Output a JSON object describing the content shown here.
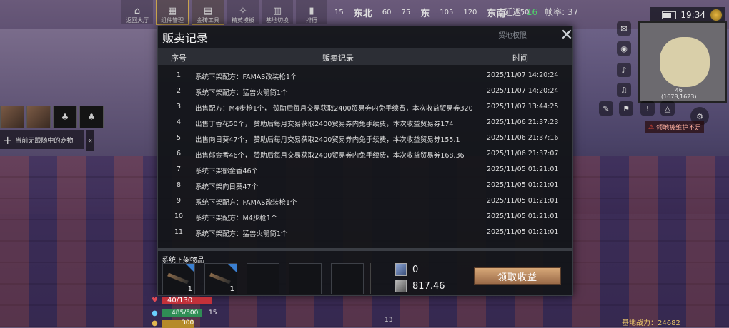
{
  "hud": {
    "home_label": "返回大厅",
    "buttons": [
      {
        "label": "组件管理",
        "active": true
      },
      {
        "label": "金砖工具",
        "active": true
      },
      {
        "label": "精英模板",
        "active": false
      },
      {
        "label": "基地切换",
        "active": false
      },
      {
        "label": "排行",
        "active": false
      }
    ],
    "compass": [
      "15",
      "东北",
      "60",
      "75",
      "东",
      "105",
      "120",
      "东南",
      "150"
    ],
    "latency_label": "延迟:",
    "latency_value": "16",
    "fps_label": "帧率:",
    "fps_value": "37",
    "clock": "19:34"
  },
  "minimap": {
    "coord_top": "46",
    "coord": "(1678,1623)"
  },
  "warning": "领地被维护不足",
  "left_panel": {
    "task_text": "当前无跟随中的宠物"
  },
  "modal": {
    "title": "贩卖记录",
    "faded_sub": "贸地权限",
    "columns": [
      "序号",
      "贩卖记录",
      "时间"
    ],
    "rows": [
      {
        "idx": "1",
        "text": "系统下架配方：FAMAS改装枪1个",
        "time": "2025/11/07 14:20:24"
      },
      {
        "idx": "2",
        "text": "系统下架配方：猛兽火箭筒1个",
        "time": "2025/11/07 14:20:24"
      },
      {
        "idx": "3",
        "text": "出售配方：M4步枪1个， 赞助后每月交易获取2400贸易券内免手续费，本次收益贸易券320",
        "time": "2025/11/07 13:44:25"
      },
      {
        "idx": "4",
        "text": "出售丁香花50个， 赞助后每月交易获取2400贸易券内免手续费，本次收益贸易券174",
        "time": "2025/11/06 21:37:23"
      },
      {
        "idx": "5",
        "text": "出售向日葵47个， 赞助后每月交易获取2400贸易券内免手续费，本次收益贸易券155.1",
        "time": "2025/11/06 21:37:16"
      },
      {
        "idx": "6",
        "text": "出售郁金香46个， 赞助后每月交易获取2400贸易券内免手续费，本次收益贸易券168.36",
        "time": "2025/11/06 21:37:07"
      },
      {
        "idx": "7",
        "text": "系统下架郁金香46个",
        "time": "2025/11/05 01:21:01"
      },
      {
        "idx": "8",
        "text": "系统下架向日葵47个",
        "time": "2025/11/05 01:21:01"
      },
      {
        "idx": "9",
        "text": "系统下架配方：FAMAS改装枪1个",
        "time": "2025/11/05 01:21:01"
      },
      {
        "idx": "10",
        "text": "系统下架配方：M4步枪1个",
        "time": "2025/11/05 01:21:01"
      },
      {
        "idx": "11",
        "text": "系统下架配方：猛兽火箭筒1个",
        "time": "2025/11/05 01:21:01"
      }
    ],
    "bottom_label": "系统下架物品",
    "slots": [
      {
        "filled": true,
        "count": "1",
        "item_icon": "rifle-icon"
      },
      {
        "filled": true,
        "count": "1",
        "item_icon": "rifle-icon"
      },
      {
        "filled": false,
        "count": ""
      },
      {
        "filled": false,
        "count": ""
      },
      {
        "filled": false,
        "count": ""
      }
    ],
    "currency1": "0",
    "currency2": "817.46",
    "claim_button": "领取收益"
  },
  "status": {
    "hp_text": "40/130",
    "energy_text": "485/500",
    "energy_extra": "15",
    "food_text": "300",
    "hotbar_num": "13",
    "power_label": "基地战力：24682"
  },
  "colors": {
    "hp": "#c2313a",
    "energy": "#2f8d55",
    "food": "#b58a2a",
    "latency": "#4fd36a",
    "claim_button": "#b88560"
  }
}
